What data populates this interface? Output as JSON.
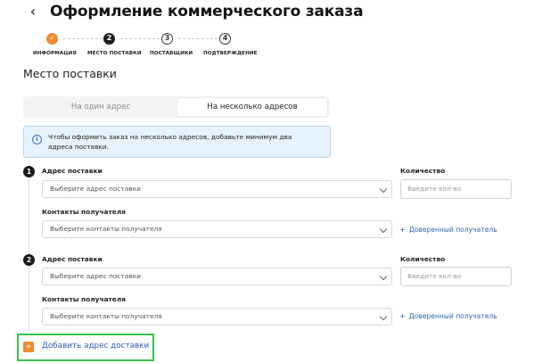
{
  "header": {
    "back_icon": "chevron-left-icon",
    "title": "Оформление коммерческого заказа"
  },
  "stepper": {
    "steps": [
      {
        "label": "ИНФОРМАЦИЯ",
        "marker": "✓",
        "state": "done"
      },
      {
        "label": "МЕСТО ПОСТАВКИ",
        "marker": "2",
        "state": "active"
      },
      {
        "label": "ПОСТАВЩИКИ",
        "marker": "3",
        "state": "todo"
      },
      {
        "label": "ПОДТВЕРЖДЕНИЕ",
        "marker": "4",
        "state": "todo"
      }
    ],
    "done_color": "#f28a2e"
  },
  "section": {
    "title": "Место поставки"
  },
  "segmented": {
    "options": [
      "На один адрес",
      "На несколько адресов"
    ],
    "selected": "На несколько адресов"
  },
  "info_banner": {
    "icon": "info-circle-icon",
    "text": "Чтобы оформить заказ на несколько адресов, добавьте минимум два адреса поставки."
  },
  "addresses": [
    {
      "number": "1",
      "address_label": "Адрес поставки",
      "address_placeholder": "Выберите адрес поставки",
      "quantity_label": "Количество",
      "quantity_placeholder": "Введите кол-во",
      "contacts_label": "Контакты получателя",
      "contacts_placeholder": "Выберите контакты получателя",
      "trusted_plus": "+",
      "trusted_label": "Доверенный получатель"
    },
    {
      "number": "2",
      "address_label": "Адрес поставки",
      "address_placeholder": "Выберите адрес поставки",
      "quantity_label": "Количество",
      "quantity_placeholder": "Введите кол-во",
      "contacts_label": "Контакты получателя",
      "contacts_placeholder": "Выберите контакты получателя",
      "trusted_plus": "+",
      "trusted_label": "Доверенный получатель"
    }
  ],
  "add_address": {
    "icon": "plus-icon",
    "icon_glyph": "+",
    "label": "Добавить адрес доставки",
    "highlight_color": "#37c54a"
  }
}
